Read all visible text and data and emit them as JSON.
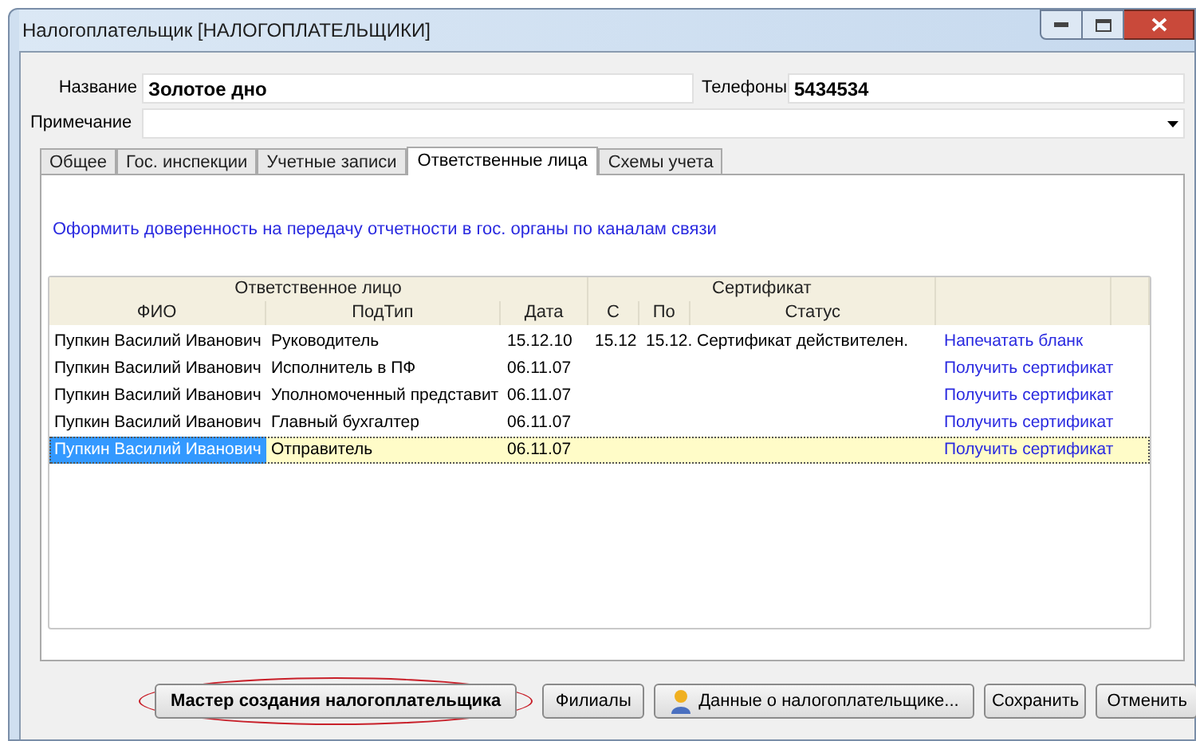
{
  "window": {
    "title": "Налогоплательщик [НАЛОГОПЛАТЕЛЬЩИКИ]"
  },
  "fields": {
    "name_label": "Название",
    "name_value": "Золотое дно",
    "phone_label": "Телефоны",
    "phone_value": "5434534",
    "note_label": "Примечание"
  },
  "tabs": [
    {
      "label": "Общее",
      "selected": false
    },
    {
      "label": "Гос. инспекции",
      "selected": false
    },
    {
      "label": "Учетные записи",
      "selected": false
    },
    {
      "label": "Ответственные лица",
      "selected": true
    },
    {
      "label": "Схемы учета",
      "selected": false
    }
  ],
  "link": "Оформить доверенность на передачу отчетности в гос. органы по каналам связи",
  "table": {
    "groups": [
      "Ответственное лицо",
      "Сертификат"
    ],
    "columns": [
      "ФИО",
      "ПодТип",
      "Дата",
      "С",
      "По",
      "Статус"
    ],
    "rows": [
      {
        "fio": "Пупкин Василий Иванович",
        "subtype": "Руководитель",
        "date": "15.12.10",
        "from": "15.12",
        "to": "15.12.",
        "status": "Сертификат действителен.",
        "action": "Напечатать бланк",
        "selected": false
      },
      {
        "fio": "Пупкин Василий Иванович",
        "subtype": "Исполнитель в ПФ",
        "date": "06.11.07",
        "action": "Получить сертификат",
        "selected": false
      },
      {
        "fio": "Пупкин Василий Иванович",
        "subtype": "Уполномоченный представит",
        "date": "06.11.07",
        "action": "Получить сертификат",
        "selected": false
      },
      {
        "fio": "Пупкин Василий Иванович",
        "subtype": "Главный бухгалтер",
        "date": "06.11.07",
        "action": "Получить сертификат",
        "selected": false
      },
      {
        "fio": "Пупкин Василий Иванович",
        "subtype": "Отправитель",
        "date": "06.11.07",
        "action": "Получить сертификат",
        "selected": true
      }
    ]
  },
  "buttons": [
    {
      "label": "Мастер создания налогоплательщика",
      "kind": "wizard"
    },
    {
      "label": "Филиалы",
      "kind": "plain"
    },
    {
      "label": "Данные о налогоплательщике...",
      "kind": "icon"
    },
    {
      "label": "Сохранить",
      "kind": "plain"
    },
    {
      "label": "Отменить",
      "kind": "plain"
    }
  ]
}
